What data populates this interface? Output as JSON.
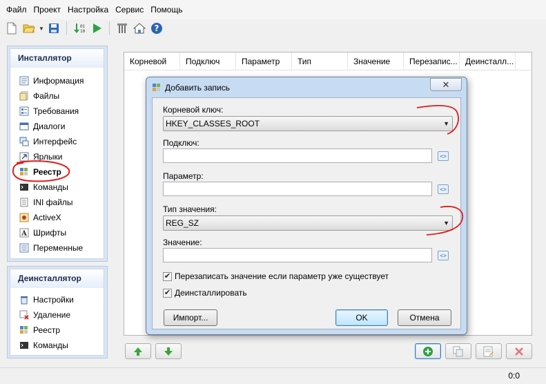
{
  "menu": [
    "Файл",
    "Проект",
    "Настройка",
    "Сервис",
    "Помощь"
  ],
  "installer_panel": {
    "title": "Инсталлятор",
    "items": [
      {
        "label": "Информация",
        "icon": "info-page-icon"
      },
      {
        "label": "Файлы",
        "icon": "files-icon"
      },
      {
        "label": "Требования",
        "icon": "requirements-icon"
      },
      {
        "label": "Диалоги",
        "icon": "dialogs-icon"
      },
      {
        "label": "Интерфейс",
        "icon": "interface-icon"
      },
      {
        "label": "Ярлыки",
        "icon": "shortcut-icon"
      },
      {
        "label": "Реестр",
        "icon": "registry-icon"
      },
      {
        "label": "Команды",
        "icon": "commands-icon"
      },
      {
        "label": "INI файлы",
        "icon": "ini-files-icon"
      },
      {
        "label": "ActiveX",
        "icon": "activex-icon"
      },
      {
        "label": "Шрифты",
        "icon": "fonts-icon"
      },
      {
        "label": "Переменные",
        "icon": "variables-icon"
      }
    ]
  },
  "uninstaller_panel": {
    "title": "Деинсталлятор",
    "items": [
      {
        "label": "Настройки",
        "icon": "settings-icon"
      },
      {
        "label": "Удаление",
        "icon": "delete-icon"
      },
      {
        "label": "Реестр",
        "icon": "registry-icon"
      },
      {
        "label": "Команды",
        "icon": "commands-icon"
      }
    ]
  },
  "list": {
    "columns": [
      "Корневой",
      "Подключ",
      "Параметр",
      "Тип",
      "Значение",
      "Перезапис...",
      "Деинсталл..."
    ]
  },
  "dialog": {
    "title": "Добавить запись",
    "root_key_label": "Корневой ключ:",
    "root_key_value": "HKEY_CLASSES_ROOT",
    "subkey_label": "Подключ:",
    "subkey_value": "",
    "param_label": "Параметр:",
    "param_value": "",
    "value_type_label": "Тип значения:",
    "value_type_value": "REG_SZ",
    "value_label": "Значение:",
    "value_value": "",
    "overwrite_label": "Перезаписать значение если параметр уже существует",
    "overwrite_checked": true,
    "uninstall_label": "Деинсталлировать",
    "uninstall_checked": true,
    "import_button": "Импорт...",
    "ok_button": "OK",
    "cancel_button": "Отмена"
  },
  "status": {
    "value": "0:0"
  },
  "colors": {
    "highlight": "#e21b1b",
    "panel_header": "#1a2b4c",
    "accent_green": "#2ea043"
  }
}
